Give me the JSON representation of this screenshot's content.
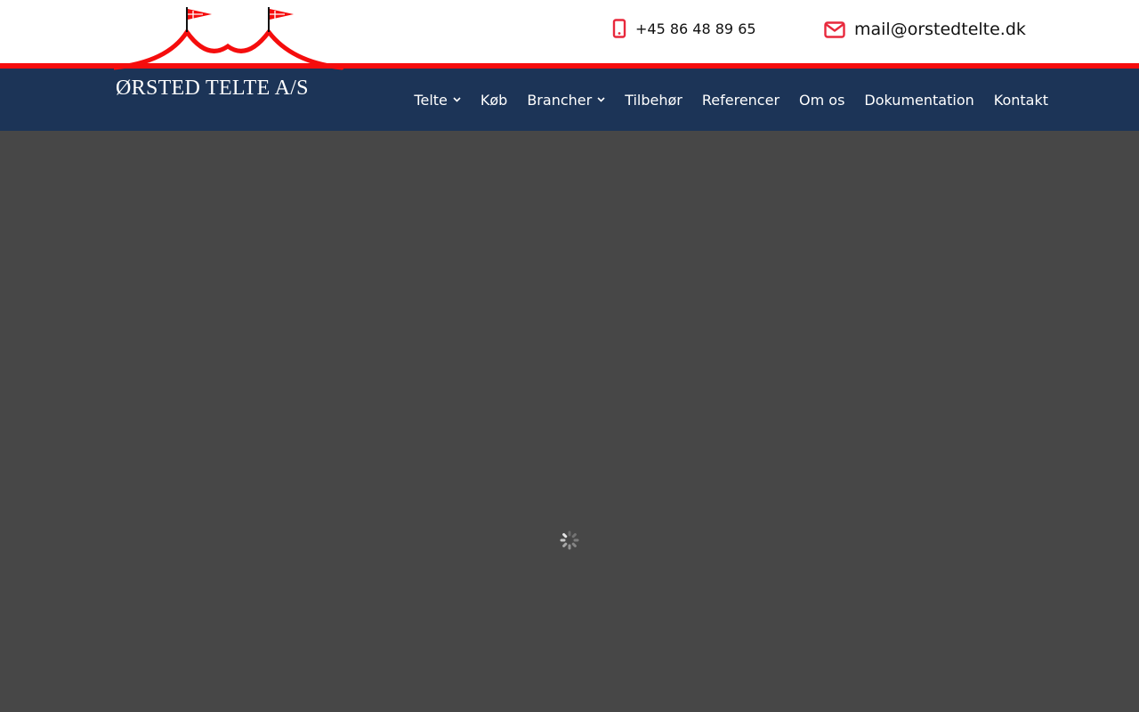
{
  "brand": {
    "name": "ØRSTED TELTE A/S",
    "primary_color": "#1c3457",
    "accent_color": "#f50d0d"
  },
  "contact": {
    "phone": "+45 86 48 89 65",
    "phone_icon": "mobile-phone-icon",
    "email": "mail@orstedtelte.dk",
    "email_icon": "envelope-icon"
  },
  "nav": {
    "items": [
      {
        "label": "Telte",
        "has_dropdown": true
      },
      {
        "label": "Køb",
        "has_dropdown": false
      },
      {
        "label": "Brancher",
        "has_dropdown": true
      },
      {
        "label": "Tilbehør",
        "has_dropdown": false
      },
      {
        "label": "Referencer",
        "has_dropdown": false
      },
      {
        "label": "Om os",
        "has_dropdown": false
      },
      {
        "label": "Dokumentation",
        "has_dropdown": false
      },
      {
        "label": "Kontakt",
        "has_dropdown": false
      }
    ]
  },
  "main": {
    "background_color": "#474747",
    "loading_icon": "spinner-icon"
  }
}
